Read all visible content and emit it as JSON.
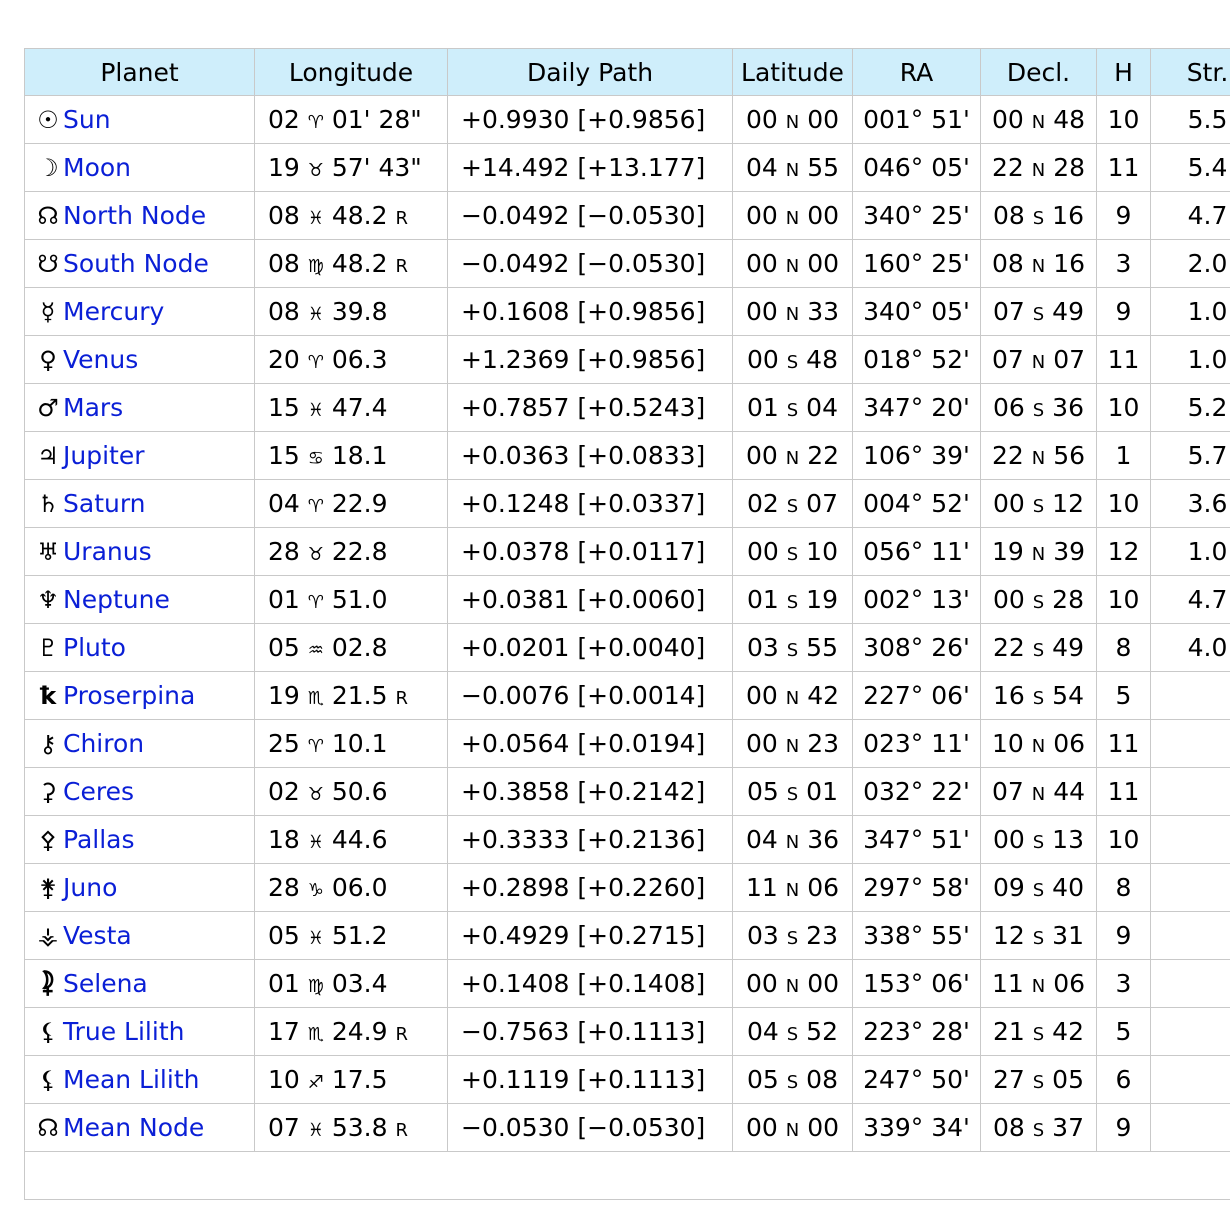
{
  "headers": [
    "Planet",
    "Longitude",
    "Daily Path",
    "Latitude",
    "RA",
    "Decl.",
    "H",
    "Str."
  ],
  "rows": [
    {
      "glyph": "☉",
      "name": "Sun",
      "lon_deg": "02",
      "lon_sign": "♈",
      "lon_min": "01' 28\"",
      "retro": "",
      "path": "+0.9930 [+0.9856]",
      "lat_a": "00",
      "lat_d": "N",
      "lat_b": "00",
      "ra": "001° 51'",
      "dec_a": "00",
      "dec_d": "N",
      "dec_b": "48",
      "h": "10",
      "str": "5.5"
    },
    {
      "glyph": "☽",
      "name": "Moon",
      "lon_deg": "19",
      "lon_sign": "♉",
      "lon_min": "57' 43\"",
      "retro": "",
      "path": "+14.492 [+13.177]",
      "lat_a": "04",
      "lat_d": "N",
      "lat_b": "55",
      "ra": "046° 05'",
      "dec_a": "22",
      "dec_d": "N",
      "dec_b": "28",
      "h": "11",
      "str": "5.4"
    },
    {
      "glyph": "☊",
      "name": "North Node",
      "lon_deg": "08",
      "lon_sign": "♓",
      "lon_min": "48.2",
      "retro": "R",
      "path": "−0.0492 [−0.0530]",
      "lat_a": "00",
      "lat_d": "N",
      "lat_b": "00",
      "ra": "340° 25'",
      "dec_a": "08",
      "dec_d": "S",
      "dec_b": "16",
      "h": "9",
      "str": "4.7"
    },
    {
      "glyph": "☋",
      "name": "South Node",
      "lon_deg": "08",
      "lon_sign": "♍",
      "lon_min": "48.2",
      "retro": "R",
      "path": "−0.0492 [−0.0530]",
      "lat_a": "00",
      "lat_d": "N",
      "lat_b": "00",
      "ra": "160° 25'",
      "dec_a": "08",
      "dec_d": "N",
      "dec_b": "16",
      "h": "3",
      "str": "2.0"
    },
    {
      "glyph": "☿",
      "name": "Mercury",
      "lon_deg": "08",
      "lon_sign": "♓",
      "lon_min": "39.8",
      "retro": "",
      "path": "+0.1608 [+0.9856]",
      "lat_a": "00",
      "lat_d": "N",
      "lat_b": "33",
      "ra": "340° 05'",
      "dec_a": "07",
      "dec_d": "S",
      "dec_b": "49",
      "h": "9",
      "str": "1.0"
    },
    {
      "glyph": "♀",
      "name": "Venus",
      "lon_deg": "20",
      "lon_sign": "♈",
      "lon_min": "06.3",
      "retro": "",
      "path": "+1.2369 [+0.9856]",
      "lat_a": "00",
      "lat_d": "S",
      "lat_b": "48",
      "ra": "018° 52'",
      "dec_a": "07",
      "dec_d": "N",
      "dec_b": "07",
      "h": "11",
      "str": "1.0"
    },
    {
      "glyph": "♂",
      "name": "Mars",
      "lon_deg": "15",
      "lon_sign": "♓",
      "lon_min": "47.4",
      "retro": "",
      "path": "+0.7857 [+0.5243]",
      "lat_a": "01",
      "lat_d": "S",
      "lat_b": "04",
      "ra": "347° 20'",
      "dec_a": "06",
      "dec_d": "S",
      "dec_b": "36",
      "h": "10",
      "str": "5.2"
    },
    {
      "glyph": "♃",
      "name": "Jupiter",
      "lon_deg": "15",
      "lon_sign": "♋",
      "lon_min": "18.1",
      "retro": "",
      "path": "+0.0363 [+0.0833]",
      "lat_a": "00",
      "lat_d": "N",
      "lat_b": "22",
      "ra": "106° 39'",
      "dec_a": "22",
      "dec_d": "N",
      "dec_b": "56",
      "h": "1",
      "str": "5.7"
    },
    {
      "glyph": "♄",
      "name": "Saturn",
      "lon_deg": "04",
      "lon_sign": "♈",
      "lon_min": "22.9",
      "retro": "",
      "path": "+0.1248 [+0.0337]",
      "lat_a": "02",
      "lat_d": "S",
      "lat_b": "07",
      "ra": "004° 52'",
      "dec_a": "00",
      "dec_d": "S",
      "dec_b": "12",
      "h": "10",
      "str": "3.6"
    },
    {
      "glyph": "♅",
      "name": "Uranus",
      "lon_deg": "28",
      "lon_sign": "♉",
      "lon_min": "22.8",
      "retro": "",
      "path": "+0.0378 [+0.0117]",
      "lat_a": "00",
      "lat_d": "S",
      "lat_b": "10",
      "ra": "056° 11'",
      "dec_a": "19",
      "dec_d": "N",
      "dec_b": "39",
      "h": "12",
      "str": "1.0"
    },
    {
      "glyph": "♆",
      "name": "Neptune",
      "lon_deg": "01",
      "lon_sign": "♈",
      "lon_min": "51.0",
      "retro": "",
      "path": "+0.0381 [+0.0060]",
      "lat_a": "01",
      "lat_d": "S",
      "lat_b": "19",
      "ra": "002° 13'",
      "dec_a": "00",
      "dec_d": "S",
      "dec_b": "28",
      "h": "10",
      "str": "4.7"
    },
    {
      "glyph": "♇",
      "name": "Pluto",
      "lon_deg": "05",
      "lon_sign": "♒",
      "lon_min": "02.8",
      "retro": "",
      "path": "+0.0201 [+0.0040]",
      "lat_a": "03",
      "lat_d": "S",
      "lat_b": "55",
      "ra": "308° 26'",
      "dec_a": "22",
      "dec_d": "S",
      "dec_b": "49",
      "h": "8",
      "str": "4.0"
    },
    {
      "glyph": "ꝁ",
      "name": "Proserpina",
      "lon_deg": "19",
      "lon_sign": "♏",
      "lon_min": "21.5",
      "retro": "R",
      "path": "−0.0076 [+0.0014]",
      "lat_a": "00",
      "lat_d": "N",
      "lat_b": "42",
      "ra": "227° 06'",
      "dec_a": "16",
      "dec_d": "S",
      "dec_b": "54",
      "h": "5",
      "str": ""
    },
    {
      "glyph": "⚷",
      "name": "Chiron",
      "lon_deg": "25",
      "lon_sign": "♈",
      "lon_min": "10.1",
      "retro": "",
      "path": "+0.0564 [+0.0194]",
      "lat_a": "00",
      "lat_d": "N",
      "lat_b": "23",
      "ra": "023° 11'",
      "dec_a": "10",
      "dec_d": "N",
      "dec_b": "06",
      "h": "11",
      "str": ""
    },
    {
      "glyph": "⚳",
      "name": "Ceres",
      "lon_deg": "02",
      "lon_sign": "♉",
      "lon_min": "50.6",
      "retro": "",
      "path": "+0.3858 [+0.2142]",
      "lat_a": "05",
      "lat_d": "S",
      "lat_b": "01",
      "ra": "032° 22'",
      "dec_a": "07",
      "dec_d": "N",
      "dec_b": "44",
      "h": "11",
      "str": ""
    },
    {
      "glyph": "⚴",
      "name": "Pallas",
      "lon_deg": "18",
      "lon_sign": "♓",
      "lon_min": "44.6",
      "retro": "",
      "path": "+0.3333 [+0.2136]",
      "lat_a": "04",
      "lat_d": "N",
      "lat_b": "36",
      "ra": "347° 51'",
      "dec_a": "00",
      "dec_d": "S",
      "dec_b": "13",
      "h": "10",
      "str": ""
    },
    {
      "glyph": "⚵",
      "name": "Juno",
      "lon_deg": "28",
      "lon_sign": "♑",
      "lon_min": "06.0",
      "retro": "",
      "path": "+0.2898 [+0.2260]",
      "lat_a": "11",
      "lat_d": "N",
      "lat_b": "06",
      "ra": "297° 58'",
      "dec_a": "09",
      "dec_d": "S",
      "dec_b": "40",
      "h": "8",
      "str": ""
    },
    {
      "glyph": "⚶",
      "name": "Vesta",
      "lon_deg": "05",
      "lon_sign": "♓",
      "lon_min": "51.2",
      "retro": "",
      "path": "+0.4929 [+0.2715]",
      "lat_a": "03",
      "lat_d": "S",
      "lat_b": "23",
      "ra": "338° 55'",
      "dec_a": "12",
      "dec_d": "S",
      "dec_b": "31",
      "h": "9",
      "str": ""
    },
    {
      "glyph": "⯝",
      "name": "Selena",
      "lon_deg": "01",
      "lon_sign": "♍",
      "lon_min": "03.4",
      "retro": "",
      "path": "+0.1408 [+0.1408]",
      "lat_a": "00",
      "lat_d": "N",
      "lat_b": "00",
      "ra": "153° 06'",
      "dec_a": "11",
      "dec_d": "N",
      "dec_b": "06",
      "h": "3",
      "str": ""
    },
    {
      "glyph": "⚸",
      "name": "True Lilith",
      "lon_deg": "17",
      "lon_sign": "♏",
      "lon_min": "24.9",
      "retro": "R",
      "path": "−0.7563 [+0.1113]",
      "lat_a": "04",
      "lat_d": "S",
      "lat_b": "52",
      "ra": "223° 28'",
      "dec_a": "21",
      "dec_d": "S",
      "dec_b": "42",
      "h": "5",
      "str": ""
    },
    {
      "glyph": "⚸",
      "name": "Mean Lilith",
      "lon_deg": "10",
      "lon_sign": "♐",
      "lon_min": "17.5",
      "retro": "",
      "path": "+0.1119 [+0.1113]",
      "lat_a": "05",
      "lat_d": "S",
      "lat_b": "08",
      "ra": "247° 50'",
      "dec_a": "27",
      "dec_d": "S",
      "dec_b": "05",
      "h": "6",
      "str": ""
    },
    {
      "glyph": "☊",
      "name": "Mean Node",
      "lon_deg": "07",
      "lon_sign": "♓",
      "lon_min": "53.8",
      "retro": "R",
      "path": "−0.0530 [−0.0530]",
      "lat_a": "00",
      "lat_d": "N",
      "lat_b": "00",
      "ra": "339° 34'",
      "dec_a": "08",
      "dec_d": "S",
      "dec_b": "37",
      "h": "9",
      "str": ""
    }
  ],
  "colors": {
    "header_bg": "#cfeefb",
    "link": "#0a1fd6",
    "border": "#c9c9c9"
  },
  "icons": [
    "sun-icon",
    "moon-icon",
    "north-node-icon",
    "south-node-icon",
    "mercury-icon",
    "venus-icon",
    "mars-icon",
    "jupiter-icon",
    "saturn-icon",
    "uranus-icon",
    "neptune-icon",
    "pluto-icon",
    "proserpina-icon",
    "chiron-icon",
    "ceres-icon",
    "pallas-icon",
    "juno-icon",
    "vesta-icon",
    "selena-icon",
    "true-lilith-icon",
    "mean-lilith-icon",
    "mean-node-icon"
  ]
}
